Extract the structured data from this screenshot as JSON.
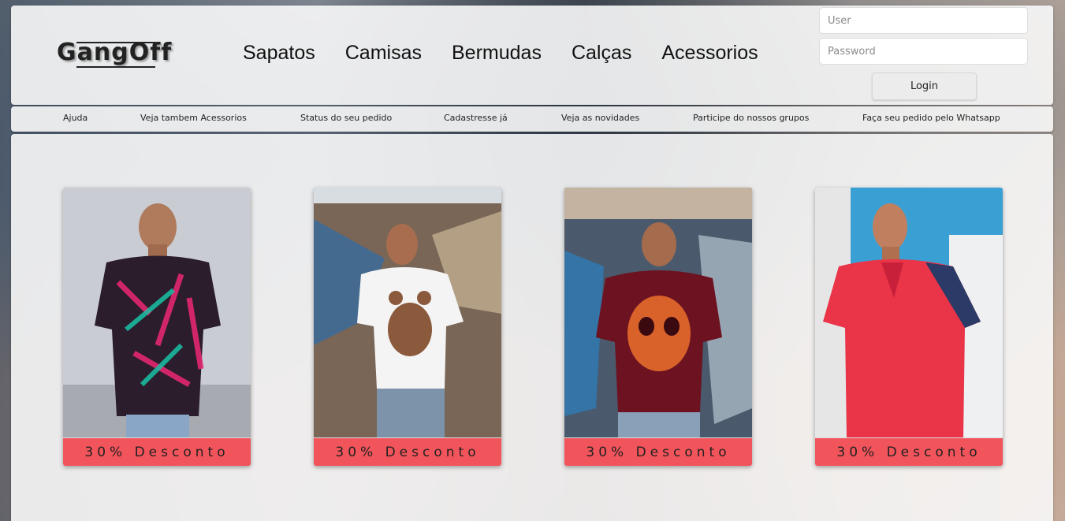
{
  "brand": {
    "logo_text": "GangOff"
  },
  "main_nav": [
    {
      "label": "Sapatos"
    },
    {
      "label": "Camisas"
    },
    {
      "label": "Bermudas"
    },
    {
      "label": "Calças"
    },
    {
      "label": "Acessorios"
    }
  ],
  "login": {
    "user_placeholder": "User",
    "password_placeholder": "Password",
    "button_label": "Login"
  },
  "secondary_nav": [
    {
      "label": "Ajuda"
    },
    {
      "label": "Veja tambem Acessorios"
    },
    {
      "label": "Status do seu pedido"
    },
    {
      "label": "Cadastresse já"
    },
    {
      "label": "Veja as novidades"
    },
    {
      "label": "Participe do nossos grupos"
    },
    {
      "label": "Faça seu pedido pelo Whatsapp"
    }
  ],
  "products": [
    {
      "badge": "30% Desconto",
      "image_icon": "floral-shirt-photo",
      "shirt_color": "#2b1d2b",
      "accent_color": "#e2286f",
      "background_color": "#c9cdd3"
    },
    {
      "badge": "30% Desconto",
      "image_icon": "bear-print-shirt-photo",
      "shirt_color": "#f4f4f4",
      "accent_color": "#8b5a3c",
      "background_color": "#7a6656"
    },
    {
      "badge": "30% Desconto",
      "image_icon": "skull-print-shirt-photo",
      "shirt_color": "#6d1220",
      "accent_color": "#d9622b",
      "background_color": "#4a5a6c"
    },
    {
      "badge": "30% Desconto",
      "image_icon": "polo-shirt-photo",
      "shirt_color": "#ea3448",
      "accent_color": "#2b3a66",
      "background_color": "#3aa0d3"
    }
  ],
  "colors": {
    "badge_background": "#f2545b",
    "panel_background": "#f8f8f8"
  }
}
